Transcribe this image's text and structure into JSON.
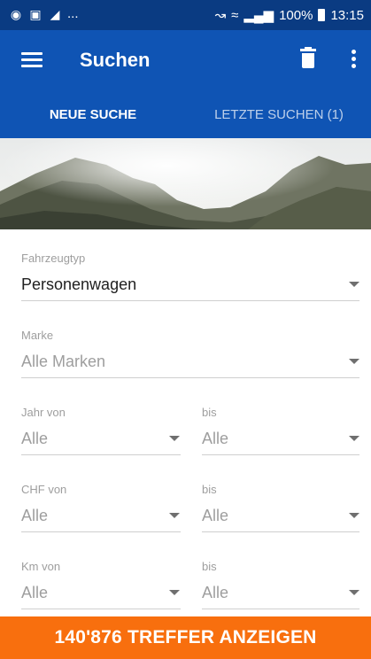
{
  "status_bar": {
    "left_icons": [
      "at-icon",
      "s-app-icon",
      "f-app-icon"
    ],
    "ellipsis": "...",
    "battery_percent": "100%",
    "time": "13:15"
  },
  "app_bar": {
    "title": "Suchen"
  },
  "tabs": [
    {
      "label": "NEUE SUCHE",
      "active": true
    },
    {
      "label": "LETZTE SUCHEN (1)",
      "active": false
    }
  ],
  "form": {
    "vehicle_type": {
      "label": "Fahrzeugtyp",
      "value": "Personenwagen"
    },
    "brand": {
      "label": "Marke",
      "value": "Alle Marken"
    },
    "year": {
      "from_label": "Jahr von",
      "from_value": "Alle",
      "to_label": "bis",
      "to_value": "Alle"
    },
    "price": {
      "from_label": "CHF von",
      "from_value": "Alle",
      "to_label": "bis",
      "to_value": "Alle"
    },
    "km": {
      "from_label": "Km von",
      "from_value": "Alle",
      "to_label": "bis",
      "to_value": "Alle"
    }
  },
  "cta": {
    "label": "140'876 TREFFER ANZEIGEN"
  },
  "colors": {
    "status_bar": "#0a3b82",
    "app_bar": "#0f54b4",
    "cta": "#f86f0e"
  }
}
